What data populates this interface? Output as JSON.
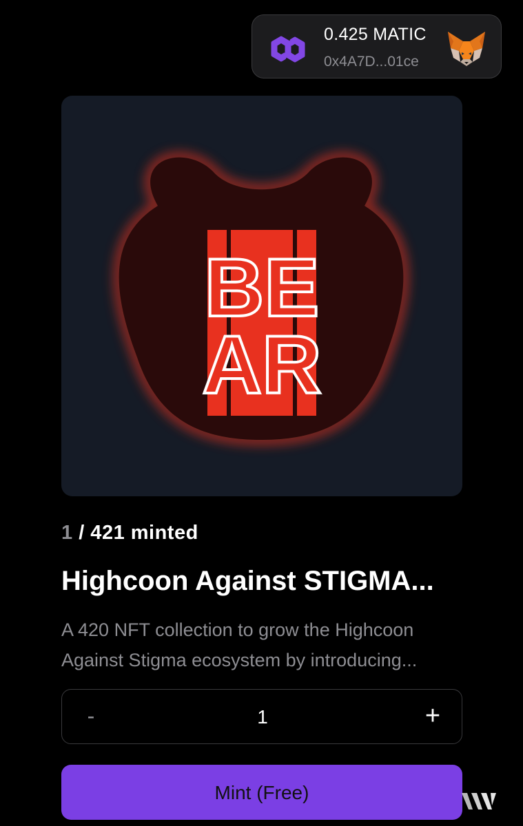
{
  "wallet": {
    "balance": "0.425 MATIC",
    "address": "0x4A7D...01ce",
    "network_icon": "polygon-icon",
    "wallet_icon": "metamask-fox-icon"
  },
  "artwork": {
    "text_line1": "BE",
    "text_line2": "AR",
    "accent_color": "#e8311f",
    "background_color": "#151b26"
  },
  "mint_info": {
    "minted_current": "1",
    "minted_rest": " / 421 minted"
  },
  "collection": {
    "title": "Highcoon Against STIGMA...",
    "description": "A 420 NFT collection to grow the Highcoon Against Stigma ecosystem by introducing..."
  },
  "stepper": {
    "minus_label": "-",
    "quantity": "1",
    "plus_label": "+"
  },
  "mint_button": {
    "label": "Mint (Free)",
    "color": "#7b3fe4"
  },
  "footer": {
    "logo_icon": "thirdweb-logo-icon"
  }
}
